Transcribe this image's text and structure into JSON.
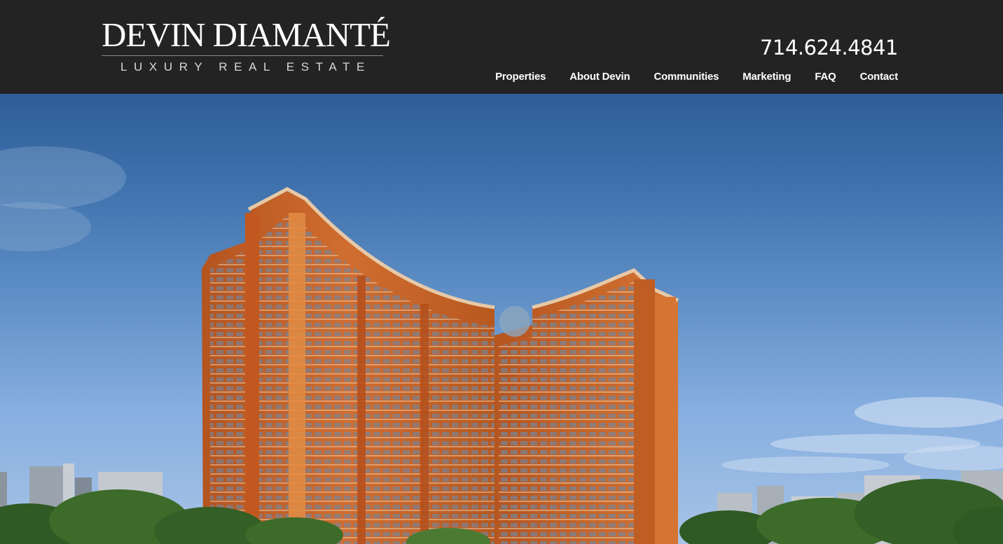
{
  "logo": {
    "name": "DEVIN DIAMANTÉ",
    "tagline": "LUXURY REAL ESTATE"
  },
  "header": {
    "phone": "714.624.4841"
  },
  "nav": {
    "items": [
      {
        "label": "Properties"
      },
      {
        "label": "About Devin"
      },
      {
        "label": "Communities"
      },
      {
        "label": "Marketing"
      },
      {
        "label": "FAQ"
      },
      {
        "label": "Contact"
      }
    ]
  },
  "hero": {
    "image": "luxury-highrise-towers-photo",
    "colors": {
      "sky_top": "#2f5e96",
      "tower_orange": "#c5622b",
      "tower_accent": "#e08a43",
      "trees": "#3c6b2a"
    }
  }
}
